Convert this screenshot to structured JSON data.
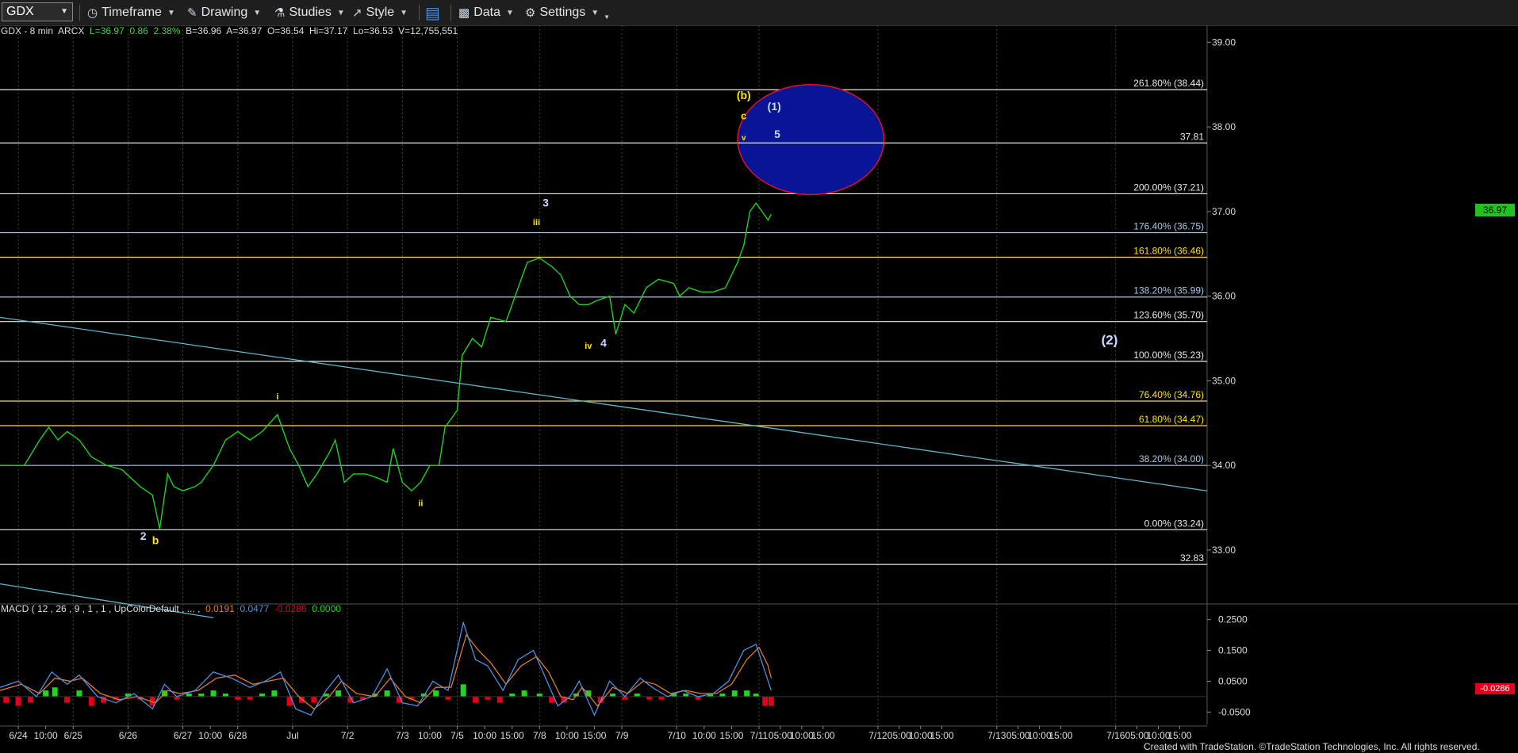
{
  "toolbar": {
    "symbol": "GDX",
    "timeframe_label": "Timeframe",
    "drawing_label": "Drawing",
    "studies_label": "Studies",
    "style_label": "Style",
    "data_label": "Data",
    "settings_label": "Settings",
    "icons": [
      "clock-icon",
      "pencil-icon",
      "flask-icon",
      "style-icon",
      "layout-icon",
      "bar-chart-icon",
      "gear-icon"
    ]
  },
  "header": {
    "ticker": "GDX - 8 min",
    "exchange": "ARCX",
    "last": "L=36.97",
    "change": "0.86",
    "change_pct": "2.38%",
    "bid": "B=36.96",
    "ask": "A=36.97",
    "open": "O=36.54",
    "high": "Hi=37.17",
    "low": "Lo=36.53",
    "volume": "V=12,755,551"
  },
  "macd_header": {
    "label": "MACD ( 12 , 26 , 9 , 1 , 1 , UpColorDefault , ... ,",
    "v1": "0.0191",
    "v2": "0.0477",
    "v3": "-0.0286",
    "v4": "0.0000"
  },
  "price_flag": "36.97",
  "macd_flag": "-0.0286",
  "footer": "Created with TradeStation. ©TradeStation Technologies, Inc. All rights reserved.",
  "colors": {
    "price": "#22d022",
    "macd_line": "#4f8fe0",
    "signal_line": "#e07b2a",
    "hist_pos": "#1fd51f",
    "hist_neg": "#e2001a",
    "ellipse_fill": "#0a1496",
    "ellipse_stroke": "#e0102a",
    "fib_white": "#e8e8e8",
    "fib_blue": "#a8c8e8",
    "fib_yellow": "#ffe500",
    "trendline": "#5fb7c9",
    "wave_blue": "#c8d8ff",
    "wave_yellow": "#ffe800"
  },
  "chart_data": {
    "type": "line",
    "title": "GDX - 8 min",
    "ylim": [
      32.4,
      39.2
    ],
    "y_ticks": [
      "39.00",
      "38.00",
      "37.00",
      "36.00",
      "35.00",
      "34.00",
      "33.00"
    ],
    "x_tick_labels": [
      "6/24",
      "10:00",
      "6/25",
      "6/26",
      "6/27",
      "10:00",
      "6/28",
      "Jul",
      "7/2",
      "7/3",
      "10:00",
      "7/5",
      "10:00",
      "15:00",
      "7/8",
      "10:00",
      "15:00",
      "7/9",
      "7/10",
      "10:00",
      "15:00",
      "7/11",
      "05:00",
      "10:00",
      "15:00",
      "7/12",
      "05:00",
      "10:00",
      "15:00",
      "7/13",
      "05:00",
      "10:00",
      "15:00",
      "7/16",
      "05:00",
      "10:00",
      "15:00"
    ],
    "x_positions": [
      0.0,
      0.45,
      0.9,
      1.8,
      2.7,
      3.15,
      3.6,
      4.5,
      5.4,
      6.3,
      6.75,
      7.2,
      7.65,
      8.1,
      8.55,
      9.0,
      9.45,
      9.9,
      10.8,
      11.25,
      11.7,
      12.15,
      12.5,
      12.85,
      13.2,
      14.1,
      14.45,
      14.8,
      15.15,
      16.05,
      16.4,
      16.75,
      17.1,
      18.0,
      18.35,
      18.7,
      19.05
    ],
    "x_range": [
      -0.3,
      19.5
    ],
    "fib_levels": [
      {
        "label": "261.80% (38.44)",
        "value": 38.44,
        "color": "white"
      },
      {
        "label": "37.81",
        "value": 37.81,
        "color": "white"
      },
      {
        "label": "200.00% (37.21)",
        "value": 37.21,
        "color": "white"
      },
      {
        "label": "176.40% (36.75)",
        "value": 36.75,
        "color": "blue"
      },
      {
        "label": "161.80% (36.46)",
        "value": 36.46,
        "color": "yellow"
      },
      {
        "label": "138.20% (35.99)",
        "value": 35.99,
        "color": "blue"
      },
      {
        "label": "123.60% (35.70)",
        "value": 35.7,
        "color": "white"
      },
      {
        "label": "100.00% (35.23)",
        "value": 35.23,
        "color": "white"
      },
      {
        "label": "76.40% (34.76)",
        "value": 34.76,
        "color": "yellow"
      },
      {
        "label": "61.80% (34.47)",
        "value": 34.47,
        "color": "yellow"
      },
      {
        "label": "38.20% (34.00)",
        "value": 34.0,
        "color": "blue"
      },
      {
        "label": "0.00% (33.24)",
        "value": 33.24,
        "color": "white"
      },
      {
        "label": "32.83",
        "value": 32.83,
        "color": "white"
      }
    ],
    "price_series": [
      [
        -0.3,
        34.0
      ],
      [
        0.1,
        34.0
      ],
      [
        0.35,
        34.3
      ],
      [
        0.5,
        34.45
      ],
      [
        0.65,
        34.3
      ],
      [
        0.8,
        34.4
      ],
      [
        1.0,
        34.3
      ],
      [
        1.2,
        34.1
      ],
      [
        1.45,
        34.0
      ],
      [
        1.7,
        33.95
      ],
      [
        2.0,
        33.75
      ],
      [
        2.2,
        33.65
      ],
      [
        2.32,
        33.25
      ],
      [
        2.45,
        33.9
      ],
      [
        2.55,
        33.75
      ],
      [
        2.7,
        33.7
      ],
      [
        2.9,
        33.75
      ],
      [
        3.0,
        33.8
      ],
      [
        3.2,
        34.0
      ],
      [
        3.4,
        34.3
      ],
      [
        3.6,
        34.4
      ],
      [
        3.8,
        34.3
      ],
      [
        4.0,
        34.4
      ],
      [
        4.25,
        34.6
      ],
      [
        4.45,
        34.2
      ],
      [
        4.6,
        34.0
      ],
      [
        4.75,
        33.75
      ],
      [
        4.9,
        33.9
      ],
      [
        5.1,
        34.15
      ],
      [
        5.2,
        34.3
      ],
      [
        5.35,
        33.8
      ],
      [
        5.5,
        33.9
      ],
      [
        5.7,
        33.9
      ],
      [
        5.9,
        33.85
      ],
      [
        6.05,
        33.8
      ],
      [
        6.15,
        34.2
      ],
      [
        6.3,
        33.8
      ],
      [
        6.45,
        33.7
      ],
      [
        6.6,
        33.8
      ],
      [
        6.75,
        34.0
      ],
      [
        6.9,
        34.0
      ],
      [
        7.0,
        34.45
      ],
      [
        7.2,
        34.65
      ],
      [
        7.28,
        35.3
      ],
      [
        7.45,
        35.5
      ],
      [
        7.6,
        35.4
      ],
      [
        7.75,
        35.75
      ],
      [
        8.0,
        35.7
      ],
      [
        8.05,
        35.8
      ],
      [
        8.15,
        36.0
      ],
      [
        8.35,
        36.4
      ],
      [
        8.55,
        36.45
      ],
      [
        8.75,
        36.35
      ],
      [
        8.9,
        36.25
      ],
      [
        9.05,
        36.0
      ],
      [
        9.2,
        35.9
      ],
      [
        9.35,
        35.9
      ],
      [
        9.5,
        35.95
      ],
      [
        9.7,
        36.0
      ],
      [
        9.8,
        35.55
      ],
      [
        9.95,
        35.9
      ],
      [
        10.1,
        35.8
      ],
      [
        10.3,
        36.1
      ],
      [
        10.5,
        36.2
      ],
      [
        10.75,
        36.15
      ],
      [
        10.85,
        36.0
      ],
      [
        11.0,
        36.1
      ],
      [
        11.2,
        36.05
      ],
      [
        11.4,
        36.05
      ],
      [
        11.6,
        36.1
      ],
      [
        11.8,
        36.4
      ],
      [
        11.9,
        36.6
      ],
      [
        12.0,
        37.0
      ],
      [
        12.1,
        37.1
      ],
      [
        12.2,
        37.0
      ],
      [
        12.3,
        36.9
      ],
      [
        12.35,
        36.97
      ]
    ],
    "trendline": [
      [
        -0.3,
        35.75
      ],
      [
        19.5,
        33.7
      ]
    ],
    "trendline2": [
      [
        -0.3,
        32.6
      ],
      [
        3.2,
        32.2
      ]
    ],
    "target_box": {
      "x": [
        11.8,
        14.2
      ],
      "y": [
        37.2,
        38.5
      ]
    },
    "wave_labels": [
      {
        "text": "(b)",
        "x": 11.9,
        "y": 38.33,
        "color": "yellow",
        "size": 14
      },
      {
        "text": "c",
        "x": 11.9,
        "y": 38.09,
        "color": "yellow",
        "size": 13
      },
      {
        "text": "v",
        "x": 11.9,
        "y": 37.84,
        "color": "yellow",
        "size": 10
      },
      {
        "text": "(1)",
        "x": 12.4,
        "y": 38.2,
        "color": "blue",
        "size": 14
      },
      {
        "text": "5",
        "x": 12.45,
        "y": 37.87,
        "color": "blue",
        "size": 14
      },
      {
        "text": "3",
        "x": 8.65,
        "y": 37.06,
        "color": "blue",
        "size": 14
      },
      {
        "text": "iii",
        "x": 8.5,
        "y": 36.84,
        "color": "yellow",
        "size": 11
      },
      {
        "text": "iv",
        "x": 9.35,
        "y": 35.38,
        "color": "yellow",
        "size": 11
      },
      {
        "text": "4",
        "x": 9.6,
        "y": 35.4,
        "color": "blue",
        "size": 14
      },
      {
        "text": "(2)",
        "x": 17.9,
        "y": 35.43,
        "color": "blue",
        "size": 17
      },
      {
        "text": "i",
        "x": 4.25,
        "y": 34.78,
        "color": "yellow",
        "size": 11
      },
      {
        "text": "ii",
        "x": 6.6,
        "y": 33.52,
        "color": "yellow",
        "size": 11
      },
      {
        "text": "2",
        "x": 2.05,
        "y": 33.12,
        "color": "blue",
        "size": 14
      },
      {
        "text": "b",
        "x": 2.25,
        "y": 33.07,
        "color": "yellow",
        "size": 14
      }
    ],
    "macd": {
      "ylim": [
        -0.08,
        0.28
      ],
      "y_ticks": [
        "0.2500",
        "0.1500",
        "0.0500",
        "-0.0500"
      ],
      "macd_line": [
        [
          -0.3,
          0.03
        ],
        [
          0.0,
          0.05
        ],
        [
          0.3,
          0.0
        ],
        [
          0.55,
          0.08
        ],
        [
          0.8,
          0.04
        ],
        [
          1.0,
          0.07
        ],
        [
          1.3,
          0.0
        ],
        [
          1.6,
          -0.02
        ],
        [
          1.9,
          0.01
        ],
        [
          2.2,
          -0.04
        ],
        [
          2.4,
          0.04
        ],
        [
          2.6,
          0.0
        ],
        [
          2.9,
          0.02
        ],
        [
          3.2,
          0.08
        ],
        [
          3.5,
          0.06
        ],
        [
          3.8,
          0.03
        ],
        [
          4.05,
          0.05
        ],
        [
          4.3,
          0.08
        ],
        [
          4.55,
          -0.04
        ],
        [
          4.8,
          -0.06
        ],
        [
          5.05,
          0.02
        ],
        [
          5.25,
          0.07
        ],
        [
          5.5,
          -0.02
        ],
        [
          5.8,
          0.0
        ],
        [
          6.05,
          0.09
        ],
        [
          6.3,
          -0.02
        ],
        [
          6.55,
          -0.03
        ],
        [
          6.8,
          0.05
        ],
        [
          7.05,
          0.02
        ],
        [
          7.3,
          0.24
        ],
        [
          7.5,
          0.12
        ],
        [
          7.7,
          0.1
        ],
        [
          7.95,
          0.02
        ],
        [
          8.2,
          0.12
        ],
        [
          8.45,
          0.15
        ],
        [
          8.65,
          0.06
        ],
        [
          8.85,
          -0.03
        ],
        [
          9.05,
          0.0
        ],
        [
          9.2,
          0.05
        ],
        [
          9.45,
          -0.06
        ],
        [
          9.7,
          0.05
        ],
        [
          9.95,
          0.0
        ],
        [
          10.2,
          0.06
        ],
        [
          10.4,
          0.03
        ],
        [
          10.65,
          0.0
        ],
        [
          10.9,
          0.02
        ],
        [
          11.15,
          0.0
        ],
        [
          11.4,
          0.01
        ],
        [
          11.65,
          0.05
        ],
        [
          11.9,
          0.15
        ],
        [
          12.1,
          0.17
        ],
        [
          12.25,
          0.08
        ],
        [
          12.35,
          0.02
        ]
      ],
      "signal_line": [
        [
          -0.3,
          0.02
        ],
        [
          0.05,
          0.04
        ],
        [
          0.35,
          0.01
        ],
        [
          0.6,
          0.06
        ],
        [
          0.85,
          0.05
        ],
        [
          1.05,
          0.06
        ],
        [
          1.35,
          0.01
        ],
        [
          1.65,
          -0.01
        ],
        [
          1.95,
          0.0
        ],
        [
          2.25,
          -0.02
        ],
        [
          2.45,
          0.02
        ],
        [
          2.65,
          0.01
        ],
        [
          2.95,
          0.02
        ],
        [
          3.25,
          0.06
        ],
        [
          3.55,
          0.07
        ],
        [
          3.85,
          0.04
        ],
        [
          4.1,
          0.05
        ],
        [
          4.35,
          0.06
        ],
        [
          4.6,
          0.0
        ],
        [
          4.85,
          -0.04
        ],
        [
          5.1,
          0.0
        ],
        [
          5.3,
          0.05
        ],
        [
          5.55,
          0.01
        ],
        [
          5.85,
          0.0
        ],
        [
          6.1,
          0.06
        ],
        [
          6.35,
          0.0
        ],
        [
          6.6,
          -0.02
        ],
        [
          6.85,
          0.03
        ],
        [
          7.1,
          0.03
        ],
        [
          7.35,
          0.2
        ],
        [
          7.55,
          0.15
        ],
        [
          7.75,
          0.11
        ],
        [
          8.0,
          0.04
        ],
        [
          8.25,
          0.1
        ],
        [
          8.5,
          0.13
        ],
        [
          8.7,
          0.08
        ],
        [
          8.9,
          0.0
        ],
        [
          9.1,
          -0.01
        ],
        [
          9.25,
          0.03
        ],
        [
          9.5,
          -0.03
        ],
        [
          9.75,
          0.03
        ],
        [
          10.0,
          0.01
        ],
        [
          10.25,
          0.05
        ],
        [
          10.45,
          0.04
        ],
        [
          10.7,
          0.01
        ],
        [
          10.95,
          0.02
        ],
        [
          11.2,
          0.01
        ],
        [
          11.45,
          0.01
        ],
        [
          11.7,
          0.04
        ],
        [
          11.95,
          0.12
        ],
        [
          12.15,
          0.16
        ],
        [
          12.3,
          0.1
        ],
        [
          12.35,
          0.06
        ]
      ],
      "histogram": [
        [
          -0.2,
          -0.02
        ],
        [
          0.0,
          -0.03
        ],
        [
          0.2,
          -0.02
        ],
        [
          0.45,
          0.02
        ],
        [
          0.6,
          0.03
        ],
        [
          0.8,
          -0.02
        ],
        [
          1.0,
          0.02
        ],
        [
          1.2,
          -0.03
        ],
        [
          1.4,
          -0.02
        ],
        [
          1.6,
          -0.01
        ],
        [
          1.8,
          0.01
        ],
        [
          2.0,
          -0.01
        ],
        [
          2.2,
          -0.03
        ],
        [
          2.4,
          0.02
        ],
        [
          2.6,
          -0.01
        ],
        [
          2.8,
          0.01
        ],
        [
          3.0,
          0.01
        ],
        [
          3.2,
          0.02
        ],
        [
          3.4,
          0.01
        ],
        [
          3.6,
          -0.01
        ],
        [
          3.8,
          -0.01
        ],
        [
          4.0,
          0.01
        ],
        [
          4.2,
          0.02
        ],
        [
          4.45,
          -0.03
        ],
        [
          4.65,
          -0.02
        ],
        [
          4.85,
          -0.02
        ],
        [
          5.05,
          0.01
        ],
        [
          5.25,
          0.02
        ],
        [
          5.45,
          -0.02
        ],
        [
          5.65,
          -0.01
        ],
        [
          5.85,
          0.01
        ],
        [
          6.05,
          0.02
        ],
        [
          6.25,
          -0.02
        ],
        [
          6.45,
          -0.01
        ],
        [
          6.65,
          0.01
        ],
        [
          6.85,
          0.02
        ],
        [
          7.05,
          -0.01
        ],
        [
          7.3,
          0.04
        ],
        [
          7.5,
          -0.02
        ],
        [
          7.7,
          -0.01
        ],
        [
          7.9,
          -0.02
        ],
        [
          8.1,
          0.01
        ],
        [
          8.3,
          0.02
        ],
        [
          8.55,
          0.01
        ],
        [
          8.75,
          -0.02
        ],
        [
          8.95,
          -0.02
        ],
        [
          9.15,
          0.01
        ],
        [
          9.35,
          0.02
        ],
        [
          9.55,
          -0.02
        ],
        [
          9.75,
          0.01
        ],
        [
          9.95,
          -0.01
        ],
        [
          10.15,
          0.01
        ],
        [
          10.35,
          -0.01
        ],
        [
          10.55,
          -0.01
        ],
        [
          10.75,
          0.01
        ],
        [
          10.95,
          0.01
        ],
        [
          11.15,
          -0.01
        ],
        [
          11.35,
          0.01
        ],
        [
          11.55,
          0.01
        ],
        [
          11.75,
          0.02
        ],
        [
          11.95,
          0.02
        ],
        [
          12.1,
          0.01
        ],
        [
          12.25,
          -0.03
        ],
        [
          12.35,
          -0.03
        ]
      ]
    }
  }
}
